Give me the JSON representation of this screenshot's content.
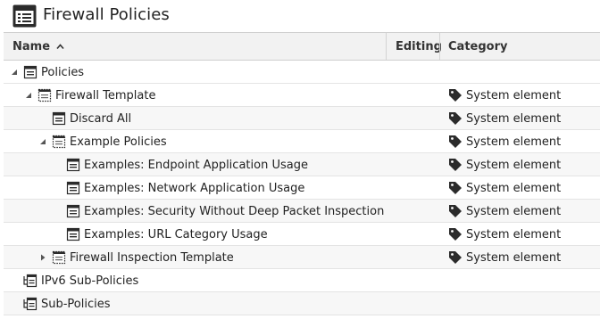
{
  "title": "Firewall Policies",
  "columns": {
    "name": "Name",
    "editing": "Editing",
    "category": "Category"
  },
  "rows": [
    {
      "label": "Policies",
      "category": ""
    },
    {
      "label": "Firewall Template",
      "category": "System element"
    },
    {
      "label": "Discard All",
      "category": "System element"
    },
    {
      "label": "Example Policies",
      "category": "System element"
    },
    {
      "label": "Examples: Endpoint Application Usage",
      "category": "System element"
    },
    {
      "label": "Examples: Network Application Usage",
      "category": "System element"
    },
    {
      "label": "Examples: Security Without Deep Packet Inspection",
      "category": "System element"
    },
    {
      "label": "Examples: URL Category Usage",
      "category": "System element"
    },
    {
      "label": "Firewall Inspection Template",
      "category": "System element"
    },
    {
      "label": "IPv6 Sub-Policies",
      "category": ""
    },
    {
      "label": "Sub-Policies",
      "category": ""
    }
  ],
  "icons": {
    "title": "policy-list-icon",
    "sort": "sort-ascending-icon",
    "category": "tag-icon"
  },
  "colors": {
    "icon": "#2b2b2b",
    "header_bg": "#f2f2f2",
    "alt_row_bg": "#f7f7f7"
  }
}
